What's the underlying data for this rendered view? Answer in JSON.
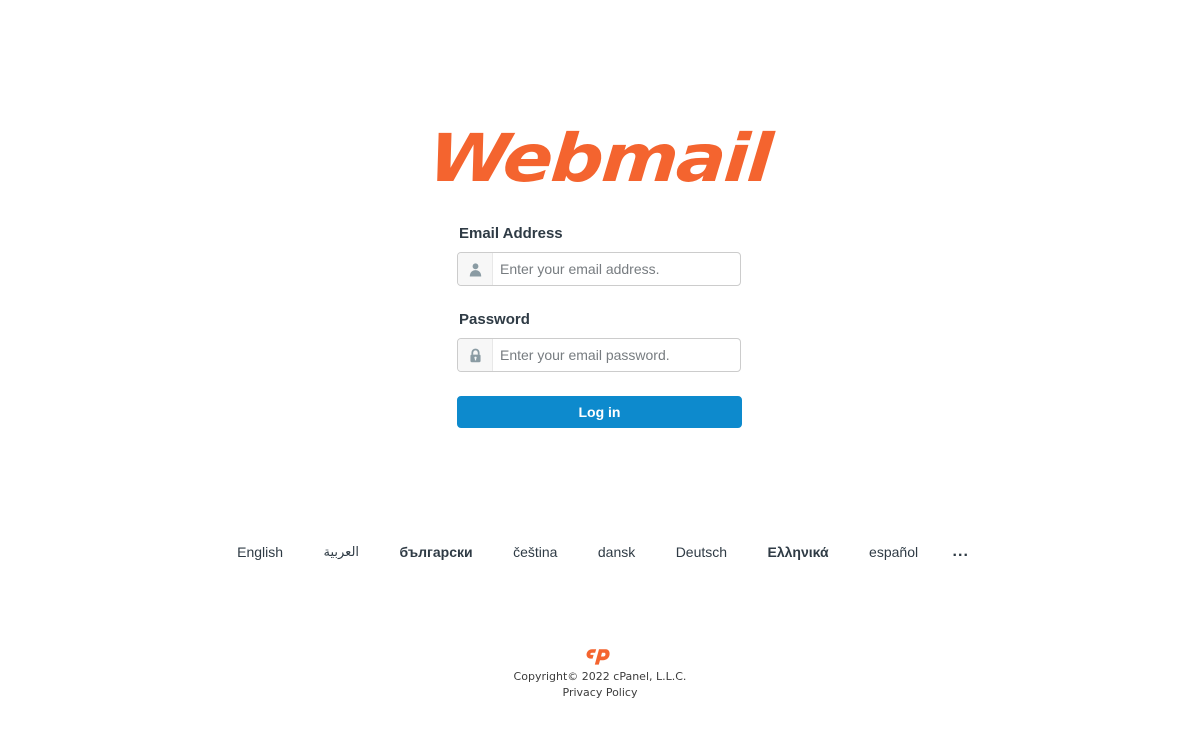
{
  "brand": {
    "logo_text": "Webmail",
    "logo_color": "#f4642f"
  },
  "form": {
    "email": {
      "label": "Email Address",
      "placeholder": "Enter your email address.",
      "value": "",
      "icon": "user-icon"
    },
    "password": {
      "label": "Password",
      "placeholder": "Enter your email password.",
      "value": "",
      "icon": "lock-icon"
    },
    "submit": {
      "label": "Log in",
      "color": "#0d8acd"
    }
  },
  "languages": {
    "items": [
      {
        "label": "English",
        "bold": false
      },
      {
        "label": "العربية",
        "bold": false
      },
      {
        "label": "български",
        "bold": true
      },
      {
        "label": "čeština",
        "bold": false
      },
      {
        "label": "dansk",
        "bold": false
      },
      {
        "label": "Deutsch",
        "bold": false
      },
      {
        "label": "Ελληνικά",
        "bold": true
      },
      {
        "label": "español",
        "bold": false
      }
    ],
    "more_label": "..."
  },
  "footer": {
    "logo_alt": "cP",
    "logo_color": "#f4642f",
    "copyright": "Copyright© 2022 cPanel, L.L.C.",
    "privacy_link": "Privacy Policy"
  }
}
